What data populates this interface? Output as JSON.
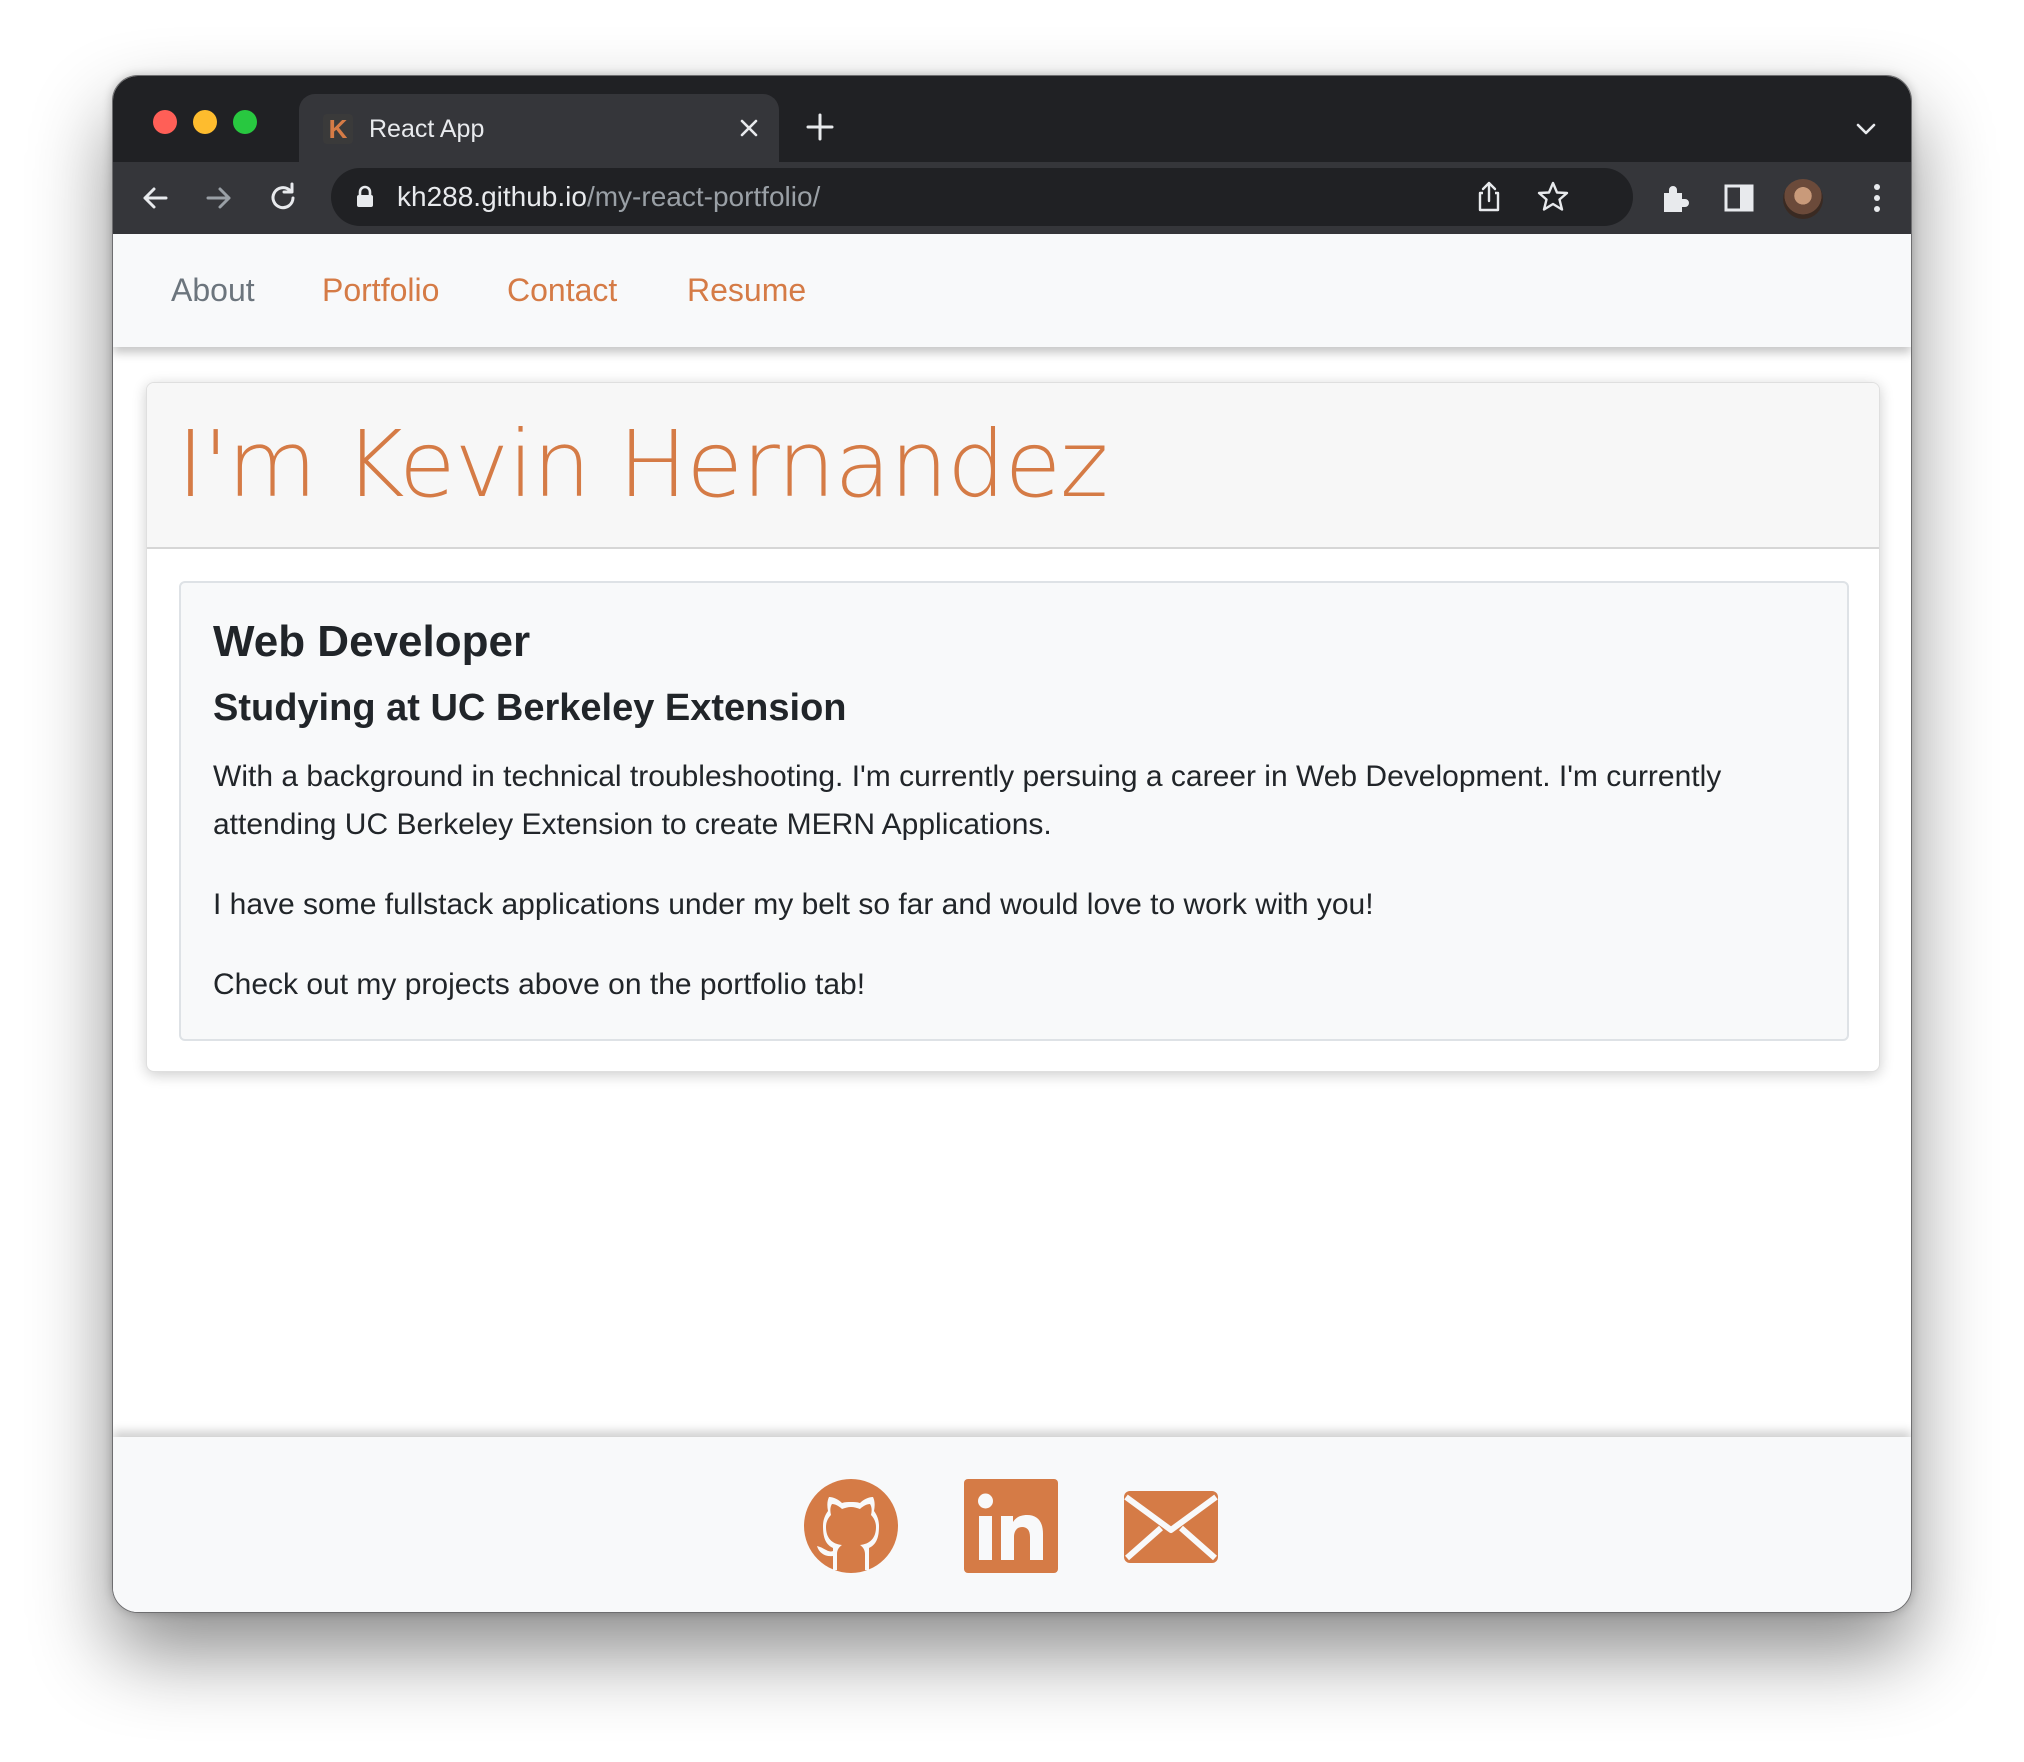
{
  "browser": {
    "tab": {
      "title": "React App",
      "favicon_letter": "K"
    },
    "address_bar": {
      "domain": "kh288.github.io",
      "path": "/my-react-portfolio/"
    },
    "icons": [
      "back-icon",
      "forward-icon",
      "reload-icon",
      "lock-icon",
      "share-icon",
      "star-icon",
      "extensions-icon",
      "sidebar-icon",
      "avatar",
      "menu-icon"
    ]
  },
  "nav": {
    "items": [
      {
        "label": "About",
        "active": true
      },
      {
        "label": "Portfolio",
        "active": false
      },
      {
        "label": "Contact",
        "active": false
      },
      {
        "label": "Resume",
        "active": false
      }
    ]
  },
  "about": {
    "title": "I'm Kevin Hernandez",
    "heading": "Web Developer",
    "subheading": "Studying at UC Berkeley Extension",
    "paragraphs": [
      "With a background in technical troubleshooting. I'm currently persuing a career in Web Development. I'm currently attending UC Berkeley Extension to create MERN Applications.",
      "I have some fullstack applications under my belt so far and would love to work with you!",
      "Check out my projects above on the portfolio tab!"
    ]
  },
  "footer": {
    "links": [
      {
        "icon": "github-icon"
      },
      {
        "icon": "linkedin-icon"
      },
      {
        "icon": "email-icon"
      }
    ]
  },
  "colors": {
    "accent": "#d57b46",
    "nav_active": "#6c757d",
    "text": "#212529",
    "chrome_dark": "#202124",
    "chrome_toolbar": "#35363a"
  }
}
